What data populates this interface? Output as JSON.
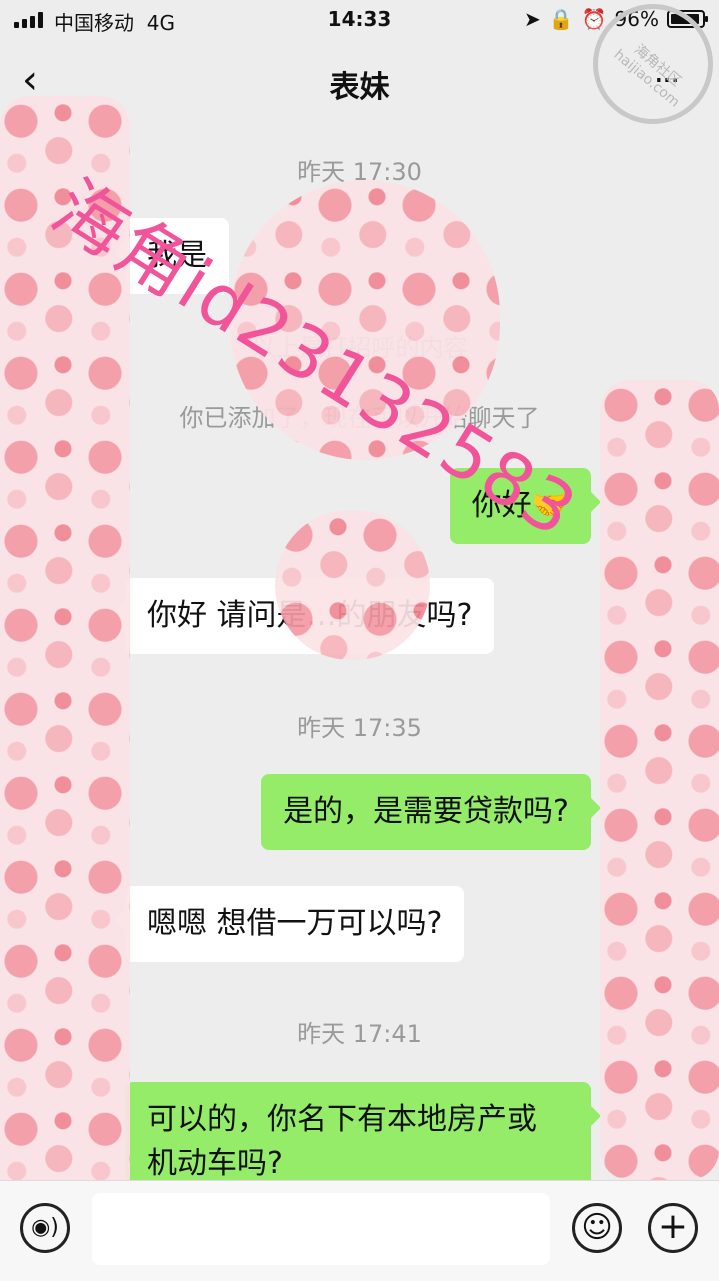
{
  "status_bar": {
    "carrier": "中国移动",
    "network": "4G",
    "time": "14:33",
    "battery_text": "96%",
    "battery_level": 0.96,
    "location_icon": "location-arrow-icon",
    "lock_icon": "orientation-lock-icon",
    "alarm_icon": "alarm-clock-icon"
  },
  "nav": {
    "back_icon": "chevron-left-icon",
    "title": "表妹",
    "more_icon": "more-dots-icon"
  },
  "messages": {
    "ts1": "昨天 17:30",
    "in1": "我是",
    "sys1": "以上是打招呼的内容",
    "sys2": "你已添加了，现在可以开始聊天了",
    "out1": "你好🤝",
    "in2": "你好 请问是…的朋友吗?",
    "ts2": "昨天 17:35",
    "out2": "是的，是需要贷款吗?",
    "in3": "嗯嗯 想借一万可以吗?",
    "ts3": "昨天 17:41",
    "out3_line1": "可以的，你名下有本地房产或",
    "out3_line2": "机动车吗?"
  },
  "overlay": {
    "watermark": "海角id23132583",
    "site_stamp": "haijiao.com",
    "site_stamp_top": "海角社区"
  },
  "input_bar": {
    "voice_icon": "voice-icon",
    "emoji_icon": "emoji-smile-icon",
    "plus_icon": "plus-circle-icon",
    "voice_glyph": "◉)",
    "emoji_glyph": "☺",
    "plus_glyph": "+"
  },
  "colors": {
    "background": "#ededed",
    "bubble_out": "#95ec69",
    "bubble_in": "#ffffff",
    "watermark": "#f2549a",
    "timestamp": "#9a9a9a"
  }
}
